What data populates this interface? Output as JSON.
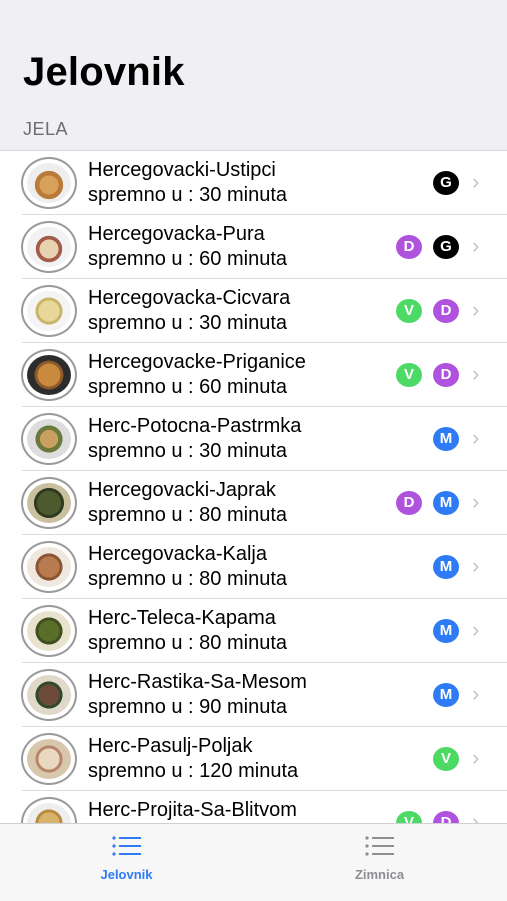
{
  "header": {
    "title": "Jelovnik",
    "section": "JELA"
  },
  "colors": {
    "G": "#000000",
    "D": "#af52de",
    "V": "#4cd964",
    "M": "#2f7bf6",
    "tab_active": "#2f7bf6",
    "tab_inactive": "#8e8e93"
  },
  "items": [
    {
      "name": "Hercegovacki-Ustipci",
      "subtitle": "spremno u : 30 minuta",
      "badges": [
        "G"
      ]
    },
    {
      "name": "Hercegovacka-Pura",
      "subtitle": "spremno u : 60 minuta",
      "badges": [
        "D",
        "G"
      ]
    },
    {
      "name": "Hercegovacka-Cicvara",
      "subtitle": "spremno u : 30 minuta",
      "badges": [
        "V",
        "D"
      ]
    },
    {
      "name": "Hercegovacke-Priganice",
      "subtitle": "spremno u : 60 minuta",
      "badges": [
        "V",
        "D"
      ]
    },
    {
      "name": "Herc-Potocna-Pastrmka",
      "subtitle": "spremno u : 30 minuta",
      "badges": [
        "M"
      ]
    },
    {
      "name": "Hercegovacki-Japrak",
      "subtitle": "spremno u : 80 minuta",
      "badges": [
        "D",
        "M"
      ]
    },
    {
      "name": "Hercegovacka-Kalja",
      "subtitle": "spremno u : 80 minuta",
      "badges": [
        "M"
      ]
    },
    {
      "name": "Herc-Teleca-Kapama",
      "subtitle": "spremno u : 80 minuta",
      "badges": [
        "M"
      ]
    },
    {
      "name": "Herc-Rastika-Sa-Mesom",
      "subtitle": "spremno u : 90 minuta",
      "badges": [
        "M"
      ]
    },
    {
      "name": "Herc-Pasulj-Poljak",
      "subtitle": "spremno u : 120 minuta",
      "badges": [
        "V"
      ]
    },
    {
      "name": "Herc-Projita-Sa-Blitvom",
      "subtitle": "",
      "badges": [
        "V",
        "D"
      ]
    }
  ],
  "tabs": [
    {
      "label": "Jelovnik",
      "icon": "list-icon",
      "active": true
    },
    {
      "label": "Zimnica",
      "icon": "list-icon",
      "active": false
    }
  ]
}
